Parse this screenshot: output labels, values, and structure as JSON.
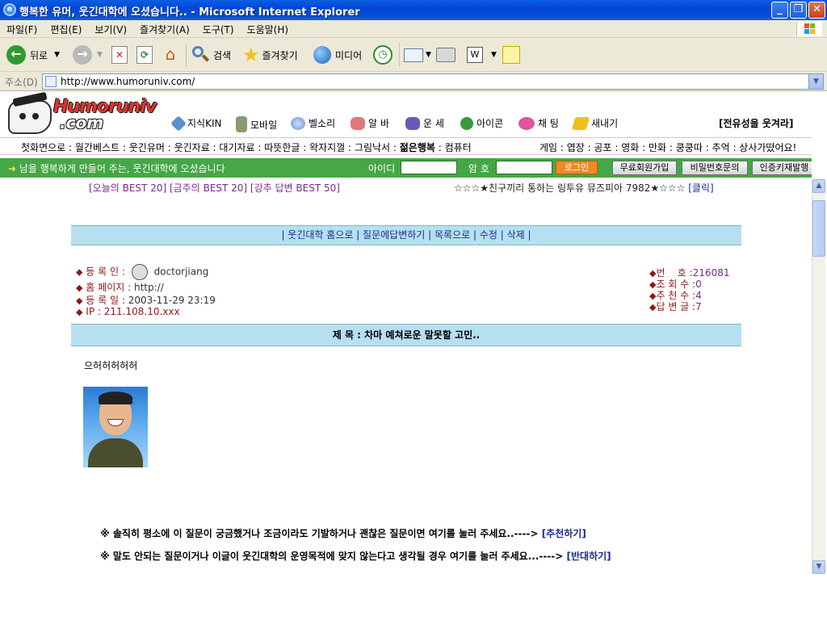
{
  "window": {
    "title": "행복한 유머, 웃긴대학에 오셨습니다.. - Microsoft Internet Explorer",
    "minimize": "_",
    "maximize": "❐",
    "close": "✕"
  },
  "menu": [
    "파일(F)",
    "편집(E)",
    "보기(V)",
    "즐겨찾기(A)",
    "도구(T)",
    "도움말(H)"
  ],
  "toolbar": {
    "back": "뒤로",
    "search": "검색",
    "favorites": "즐겨찾기",
    "media": "미디어"
  },
  "address": {
    "label": "주소(D)",
    "url": "http://www.humoruniv.com/"
  },
  "site": {
    "logo_top": "Humoruniv",
    "logo_bottom": ".com",
    "nav": [
      "지식KIN",
      "모바일",
      "벨소리",
      "알 바",
      "운 세",
      "아이콘",
      "채 팅",
      "새내기"
    ],
    "slogan": "[전유성을 웃겨라]",
    "categories_left": "첫화면으로 : 월간베스트 : 웃긴유머 : 웃긴자료 : 대기자료 : 따뜻한글 : 왁자지껄 : 그림낙서 : ",
    "categories_bold": "젊은행복",
    "categories_tail": " : 컴퓨터",
    "categories_right": "게임 : 엽장 : 공포 : 영화 : 만화 : 쿵쿵따 : 추억 : 상사가떴어요!",
    "greeting": "남을 행복하게 만들어 주는, 웃긴대학에 오셨습니다",
    "id_label": "아이디",
    "pw_label": "암 호",
    "login": "로그인",
    "signup": "무료회원가입",
    "find_pw": "비밀번호문의",
    "cert": "인증키재발행",
    "best_links": "[오늘의 BEST 20] [금주의 BEST 20] [강추 답변 BEST 50]",
    "promo": "☆☆☆★친구끼리 통하는 링투유 뮤즈피아 7982★☆☆☆",
    "promo_click": "[클릭]"
  },
  "post": {
    "actions": "| 웃긴대학 홈으로 | 질문에답변하기 | 목록으로 | 수정 | 삭제 |",
    "author_label": "등 록 인 :",
    "author": "doctorjiang",
    "homepage_label": "홈 페이지 :",
    "homepage": "http://",
    "date_label": "등 록 일 :",
    "date": "2003-11-29 23:19",
    "ip_label": "IP :",
    "ip": "211.108.10.xxx",
    "number_label": "번    호 :",
    "number": "216081",
    "views_label": "조 회 수 :",
    "views": "0",
    "recommend_label": "추 천 수 :",
    "recommend": "4",
    "replies_label": "답 변 글 :",
    "replies": "7",
    "title": "제 목 : 차마 예쳐로운 말못할 고민..",
    "body": "으허허허허허",
    "note1": "※ 솔직히 평소에 이 질문이 궁금했거나 조금이라도 기발하거나 괜찮은 질문이면 여기를 눌러 주세요..---->",
    "note1_link": "[추천하기]",
    "note2": "※ 말도 안되는 질문이거나 이글이 웃긴대학의 운영목적에 맞지 않는다고 생각될 경우 여기를 눌러 주세요...---->",
    "note2_link": "[반대하기]"
  },
  "colors": {
    "titlebar": "#0345d8",
    "green_bar": "#45a745",
    "light_blue": "#b6e0f0",
    "link_blue": "#1a2b8a"
  }
}
